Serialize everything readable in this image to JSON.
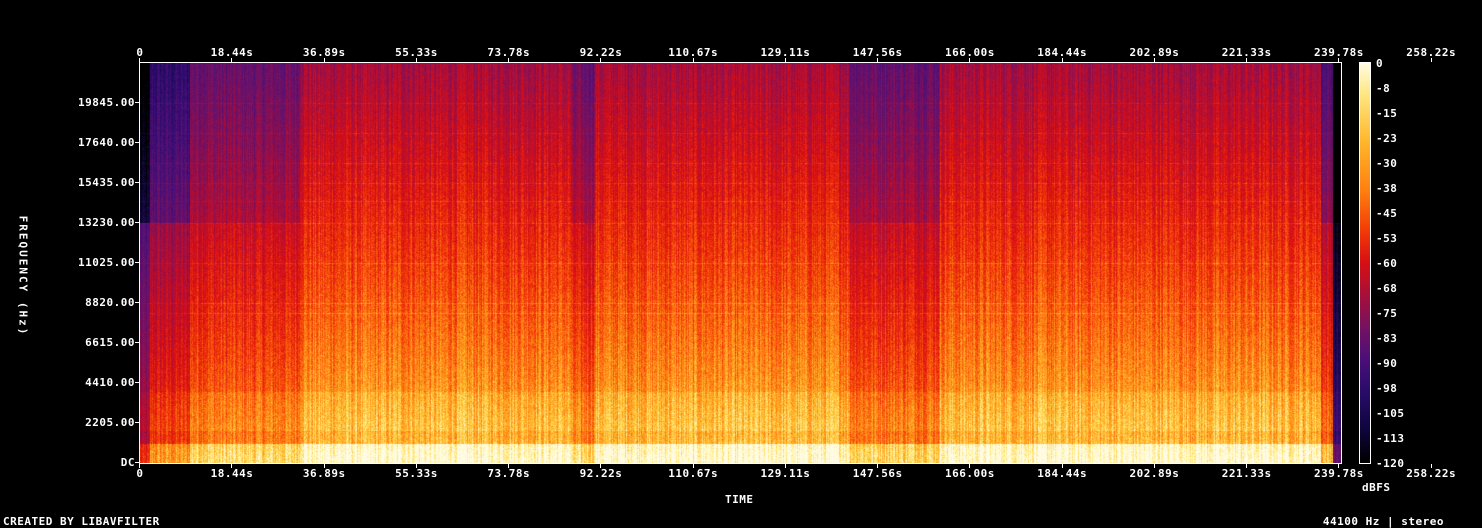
{
  "chart_data": {
    "type": "heatmap",
    "title": "",
    "xlabel": "TIME",
    "ylabel": "FREQUENCY (Hz)",
    "colorbar_label": "dBFS",
    "x_ticks": [
      "0",
      "18.44s",
      "36.89s",
      "55.33s",
      "73.78s",
      "92.22s",
      "110.67s",
      "129.11s",
      "147.56s",
      "166.00s",
      "184.44s",
      "202.89s",
      "221.33s",
      "239.78s",
      "258.22s"
    ],
    "y_ticks": [
      "DC",
      "2205.00",
      "4410.00",
      "6615.00",
      "8820.00",
      "11025.00",
      "13230.00",
      "15435.00",
      "17640.00",
      "19845.00"
    ],
    "colorbar_ticks": [
      "0",
      "-8",
      "-15",
      "-23",
      "-30",
      "-38",
      "-45",
      "-53",
      "-60",
      "-68",
      "-75",
      "-83",
      "-90",
      "-98",
      "-105",
      "-113",
      "-120"
    ],
    "xlim": [
      0,
      276.67
    ],
    "ylim": [
      0,
      22050
    ],
    "zlim": [
      -120,
      0
    ],
    "colormap": "fire (black-purple-red-orange-yellow-white)"
  },
  "footer": {
    "left": "CREATED BY LIBAVFILTER",
    "right": "44100 Hz | stereo"
  }
}
